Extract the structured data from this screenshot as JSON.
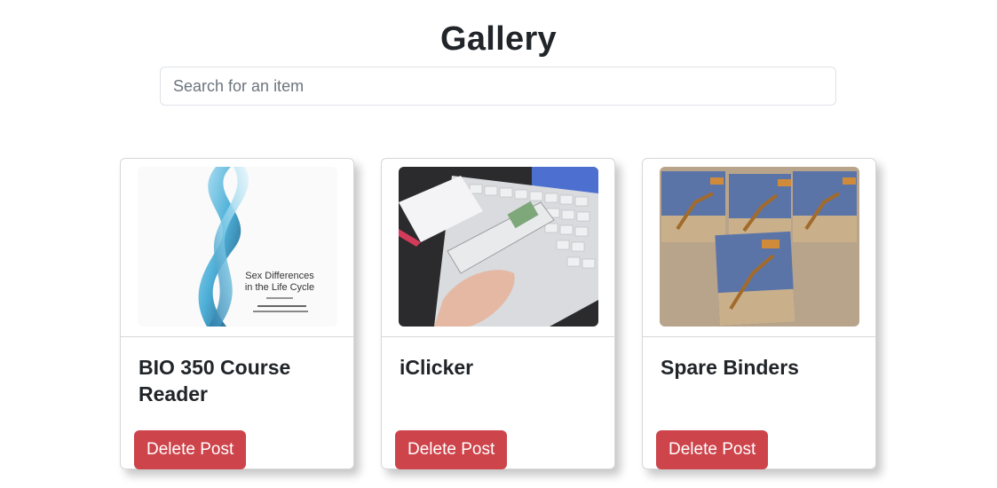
{
  "page": {
    "title": "Gallery"
  },
  "search": {
    "placeholder": "Search for an item",
    "value": ""
  },
  "cards": [
    {
      "title": "BIO 350 Course Reader",
      "delete_label": "Delete Post",
      "image": {
        "kind": "book-cover",
        "cover_title_line1": "Sex Differences",
        "cover_title_line2": "in the Life Cycle"
      }
    },
    {
      "title": "iClicker",
      "delete_label": "Delete Post",
      "image": {
        "kind": "photo-clicker-keyboard"
      }
    },
    {
      "title": "Spare Binders",
      "delete_label": "Delete Post",
      "image": {
        "kind": "photo-binders-giraffe"
      }
    }
  ],
  "colors": {
    "delete_button": "#cd444b",
    "card_border": "#d6d8db",
    "text": "#212529"
  }
}
